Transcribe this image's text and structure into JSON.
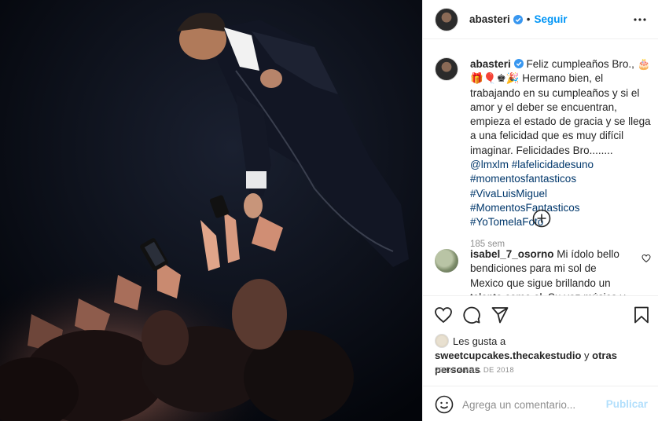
{
  "post": {
    "username": "abasteri",
    "follow_label": "Seguir",
    "dot": "•",
    "caption": {
      "username": "abasteri",
      "text_1": " Feliz cumpleaños Bro., 🎂🎁🎈♚🎉 Hermano bien, el trabajando en su cumpleaños y si el amor y el deber se encuentran, empieza el estado de gracia y se llega a una felicidad que es muy difícil imaginar. Felicidades Bro........ ",
      "mention": "@lmxlm",
      "tags": "#lafelicidadesuno #momentosfantasticos #VivaLuisMiguel #MomentosFantasticos #YoTomelaFoto",
      "time": "185 sem"
    },
    "comment": {
      "username": "isabel_7_osorno",
      "text": " Mi ídolo bello bendiciones para mi sol de Mexico que sigue brillando un talento como el. Su voz música y mucho mas"
    },
    "likes": {
      "prefix": "Les gusta a ",
      "user": "sweetcupcakes.thecakestudio",
      "mid": " y ",
      "others": "otras personas"
    },
    "date": "20 DE ABRIL DE 2018",
    "add_comment_placeholder": "Agrega un comentario...",
    "publish_label": "Publicar"
  },
  "icons": {
    "verified": "verified-badge-icon",
    "more": "more-options-icon",
    "load_more": "plus-circle-icon",
    "like": "heart-icon",
    "comment": "comment-icon",
    "share": "paper-plane-icon",
    "save": "bookmark-icon",
    "emoji": "emoji-icon"
  },
  "colors": {
    "link": "#0095f6",
    "hashtag": "#00376b",
    "publish_disabled": "#b2dffc",
    "muted": "#8e8e8e",
    "border": "#efefef"
  }
}
